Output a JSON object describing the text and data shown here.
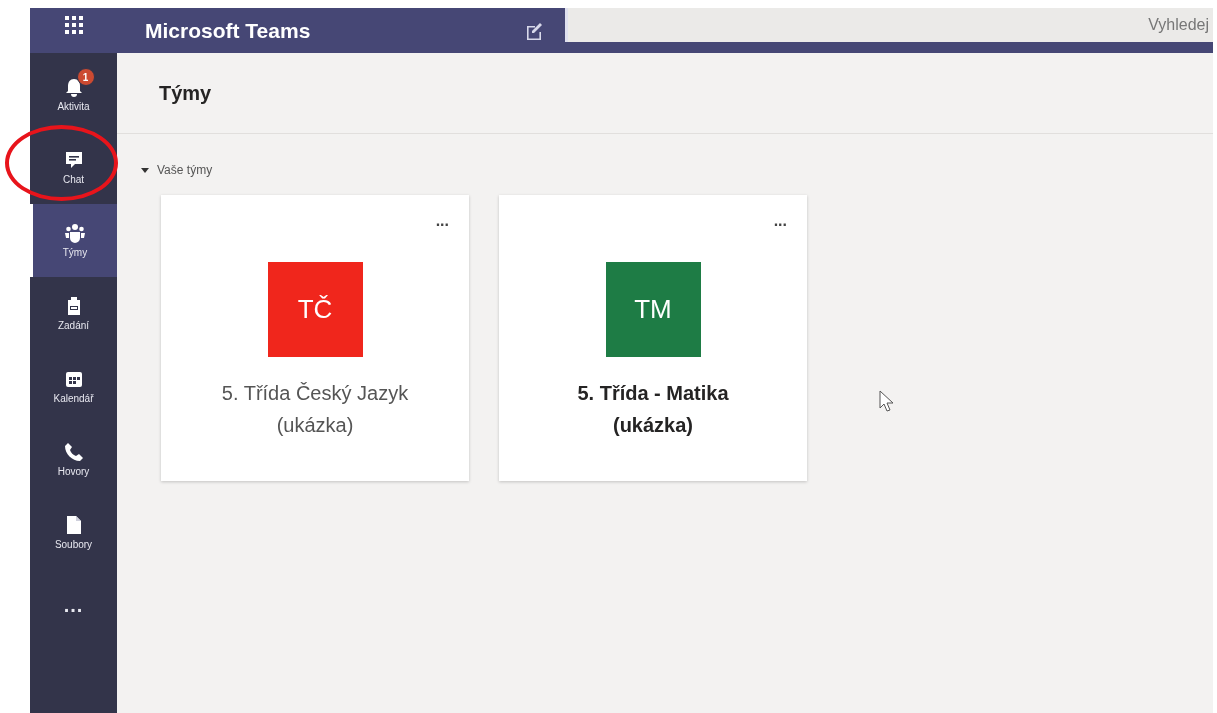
{
  "app_bar": {
    "title": "Microsoft Teams",
    "search": {
      "placeholder": "Vyhledej"
    }
  },
  "nav": [
    {
      "kind": "bell",
      "label": "Aktivita",
      "selected": false,
      "badge": "1"
    },
    {
      "kind": "chat",
      "label": "Chat",
      "selected": false,
      "annotated": true
    },
    {
      "kind": "teams",
      "label": "Týmy",
      "selected": true
    },
    {
      "kind": "assignment",
      "label": "Zadání",
      "selected": false
    },
    {
      "kind": "calendar",
      "label": "Kalendář",
      "selected": false
    },
    {
      "kind": "phone",
      "label": "Hovory",
      "selected": false
    },
    {
      "kind": "file",
      "label": "Soubory",
      "selected": false
    },
    {
      "kind": "more",
      "label": "...",
      "selected": false
    }
  ],
  "page": {
    "title": "Týmy",
    "section": {
      "label": "Vaše týmy",
      "expanded": true
    },
    "teams": [
      {
        "initials": "TČ",
        "name": "5. Třída Český Jazyk (ukázka)",
        "color": "#f0261c",
        "unread": false,
        "menu": "..."
      },
      {
        "initials": "TM",
        "name": "5. Třída - Matika (ukázka)",
        "color": "#1e7c45",
        "unread": true,
        "menu": "..."
      }
    ]
  }
}
